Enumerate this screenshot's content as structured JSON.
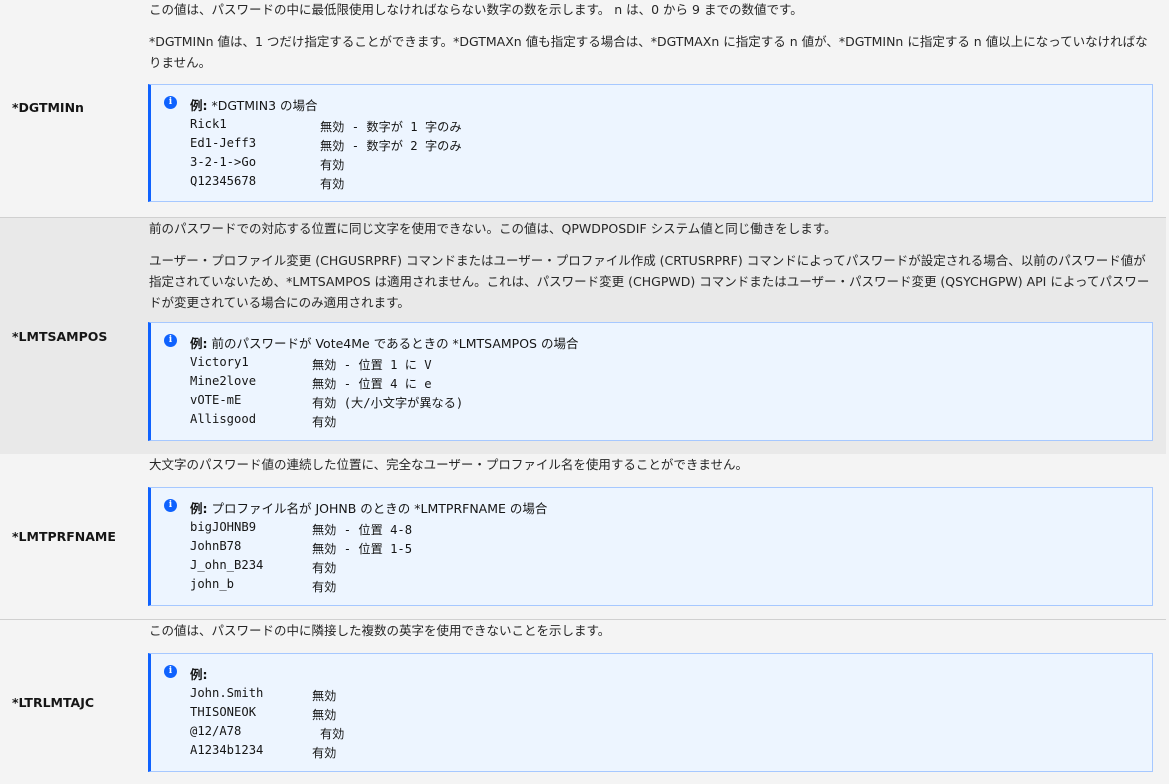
{
  "rows": [
    {
      "key": "*DGTMINn",
      "desc": [
        "この値は、パスワードの中に最低限使用しなければならない数字の数を示します。 n は、0 から 9 までの数値です。",
        "*DGTMINn 値は、1 つだけ指定することができます。*DGTMAXn 値も指定する場合は、*DGTMAXn に指定する n 値が、*DGTMINn に指定する n 値以上になっていなければなりません。"
      ],
      "note": {
        "label": "例:",
        "text": "*DGTMIN3 の場合",
        "examples": [
          {
            "pw": "Rick1",
            "res": "無効 - 数字が 1 字のみ"
          },
          {
            "pw": "Ed1-Jeff3",
            "res": "無効 - 数字が 2 字のみ"
          },
          {
            "pw": "3-2-1->Go",
            "res": "有効"
          },
          {
            "pw": "Q12345678",
            "res": "有効"
          }
        ]
      }
    },
    {
      "key": "*LMTSAMPOS",
      "desc": [
        "前のパスワードでの対応する位置に同じ文字を使用できない。この値は、QPWDPOSDIF システム値と同じ働きをします。",
        "ユーザー・プロファイル変更 (CHGUSRPRF) コマンドまたはユーザー・プロファイル作成 (CRTUSRPRF) コマンドによってパスワードが設定される場合、以前のパスワード値が指定されていないため、*LMTSAMPOS は適用されません。これは、パスワード変更 (CHGPWD) コマンドまたはユーザー・パスワード変更 (QSYCHGPW) API によってパスワードが変更されている場合にのみ適用されます。"
      ],
      "note": {
        "label": "例:",
        "text": "前のパスワードが Vote4Me であるときの *LMTSAMPOS の場合",
        "examples": [
          {
            "pw": "Victory1",
            "res": "無効 - 位置 1 に V"
          },
          {
            "pw": "Mine2love",
            "res": "無効 - 位置 4 に e"
          },
          {
            "pw": "vOTE-mE",
            "res": "有効 (大/小文字が異なる)"
          },
          {
            "pw": "Allisgood",
            "res": "有効"
          }
        ]
      }
    },
    {
      "key": "*LMTPRFNAME",
      "desc": [
        "大文字のパスワード値の連続した位置に、完全なユーザー・プロファイル名を使用することができません。"
      ],
      "note": {
        "label": "例:",
        "text": "プロファイル名が JOHNB のときの *LMTPRFNAME の場合",
        "examples": [
          {
            "pw": "bigJOHNB9",
            "res": "無効 - 位置 4-8"
          },
          {
            "pw": "JohnB78",
            "res": "無効 - 位置 1-5"
          },
          {
            "pw": "J_ohn_B234",
            "res": "有効"
          },
          {
            "pw": "john_b",
            "res": "有効"
          }
        ]
      }
    },
    {
      "key": "*LTRLMTAJC",
      "desc": [
        "この値は、パスワードの中に隣接した複数の英字を使用できないことを示します。"
      ],
      "note": {
        "label": "例:",
        "text": "",
        "examples": [
          {
            "pw": "John.Smith",
            "res": "無効"
          },
          {
            "pw": "THISONEOK",
            "res": "無効"
          },
          {
            "pw": "@12/A78",
            "res": "有効"
          },
          {
            "pw": "A1234b1234",
            "res": "有効"
          }
        ]
      }
    }
  ],
  "colors": {
    "note_bg": "#edf5ff",
    "note_accent": "#0f62fe",
    "alt_row": "#e9e9e9"
  },
  "icons": {
    "note": "info-icon"
  },
  "info_glyph": "i"
}
